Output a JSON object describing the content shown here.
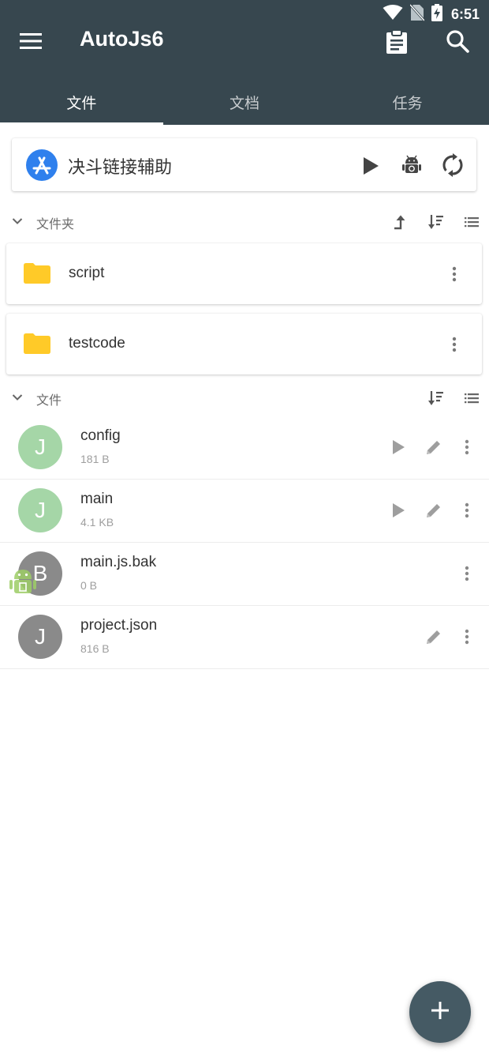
{
  "status_bar": {
    "time": "6:51",
    "icons": [
      "wifi-icon",
      "no-sim-icon",
      "battery-charging-icon"
    ]
  },
  "app_bar": {
    "title": "AutoJs6",
    "menu_icon": "menu-icon",
    "actions": [
      "clipboard-icon",
      "search-icon"
    ]
  },
  "tabs": [
    {
      "label": "文件",
      "active": true
    },
    {
      "label": "文档",
      "active": false
    },
    {
      "label": "任务",
      "active": false
    }
  ],
  "project": {
    "name": "决斗链接辅助",
    "icon": "app-store-icon",
    "actions": [
      "play-icon",
      "android-build-icon",
      "sync-icon"
    ]
  },
  "folders_section": {
    "label": "文件夹",
    "actions": [
      "go-up-icon",
      "sort-icon",
      "list-view-icon"
    ],
    "items": [
      {
        "name": "script"
      },
      {
        "name": "testcode"
      }
    ]
  },
  "files_section": {
    "label": "文件",
    "actions": [
      "sort-icon",
      "list-view-icon"
    ],
    "items": [
      {
        "letter": "J",
        "name": "config",
        "size": "181 B",
        "color": "#a5d6a7",
        "runnable": true,
        "editable": true
      },
      {
        "letter": "J",
        "name": "main",
        "size": "4.1 KB",
        "color": "#a5d6a7",
        "runnable": true,
        "editable": true
      },
      {
        "letter": "B",
        "name": "main.js.bak",
        "size": "0 B",
        "color": "#8a8a8a",
        "runnable": false,
        "editable": false
      },
      {
        "letter": "J",
        "name": "project.json",
        "size": "816 B",
        "color": "#8a8a8a",
        "runnable": false,
        "editable": true
      }
    ]
  },
  "fab": {
    "icon": "plus-icon"
  },
  "colors": {
    "primary": "#37474f",
    "fab": "#455a64",
    "js_file": "#a5d6a7",
    "other_file": "#8a8a8a",
    "folder": "#ffca28"
  }
}
